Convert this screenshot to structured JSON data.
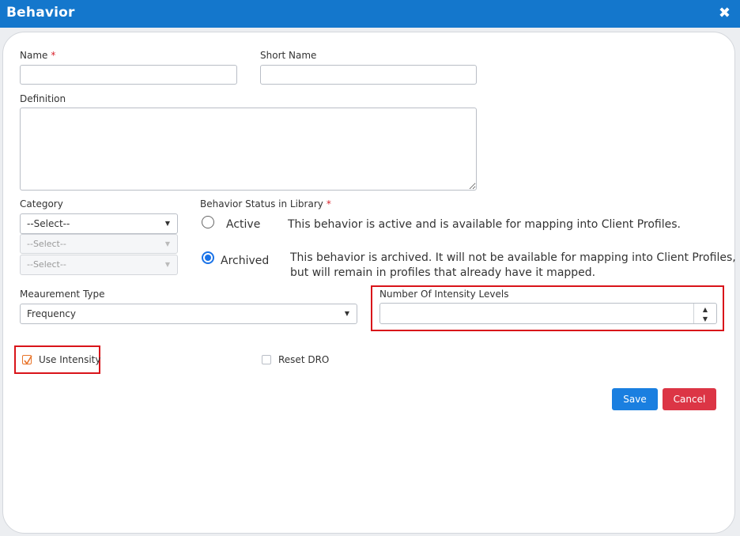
{
  "window": {
    "title": "Behavior",
    "close_icon": "close-icon"
  },
  "form": {
    "name_label": "Name",
    "name_value": "",
    "short_name_label": "Short Name",
    "short_name_value": "",
    "definition_label": "Definition",
    "definition_value": "",
    "required_mark": "*",
    "category": {
      "label": "Category",
      "selected": "--Select--",
      "sub1": "--Select--",
      "sub2": "--Select--"
    },
    "status": {
      "label": "Behavior Status in Library",
      "options": [
        {
          "label": "Active",
          "checked": false,
          "description": "This behavior is active and is available for mapping into Client Profiles."
        },
        {
          "label": "Archived",
          "checked": true,
          "description_line1": "This behavior is archived. It will not be available for mapping into Client Profiles,",
          "description_line2": "but will remain in profiles that already have it mapped."
        }
      ]
    },
    "measurement_type": {
      "label": "Meaurement Type",
      "selected": "Frequency"
    },
    "intensity_levels": {
      "label": "Number Of Intensity Levels",
      "value": ""
    },
    "use_intensity": {
      "label": "Use Intensity",
      "checked": true
    },
    "reset_dro": {
      "label": "Reset DRO",
      "checked": false
    }
  },
  "buttons": {
    "save": "Save",
    "cancel": "Cancel"
  },
  "colors": {
    "title_bar": "#1477cc",
    "save": "#1a7fe0",
    "cancel": "#dc3545",
    "highlight": "#d9141a",
    "required": "#d9232d"
  }
}
